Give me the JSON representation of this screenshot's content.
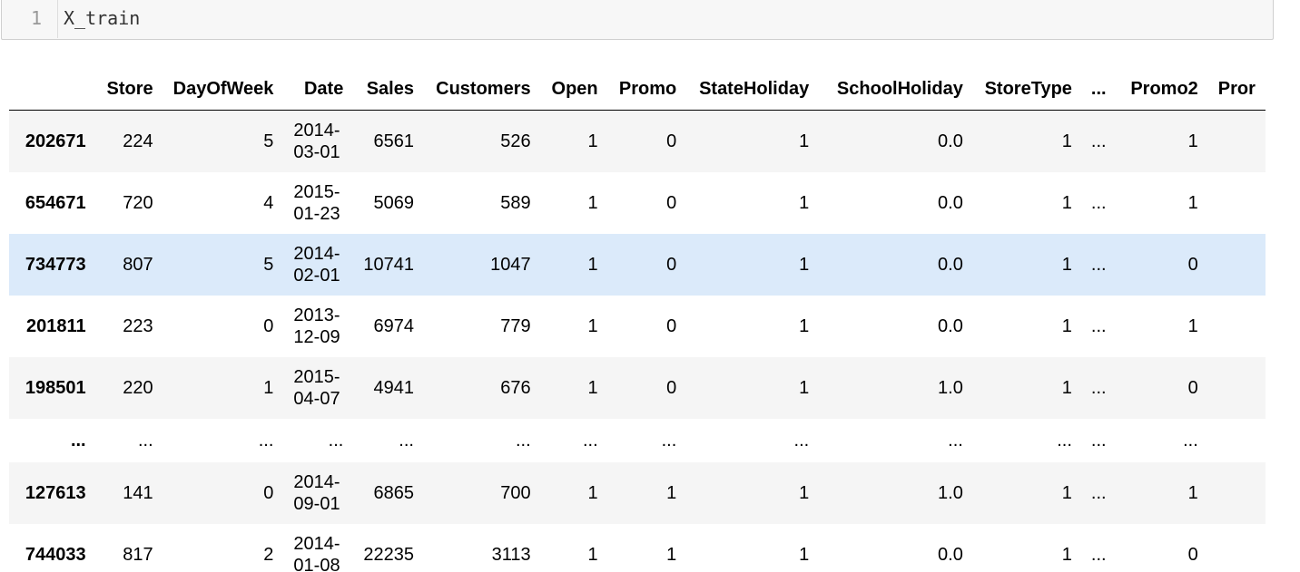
{
  "code_cell": {
    "line_number": "1",
    "code": "X_train"
  },
  "dataframe": {
    "columns": [
      "Store",
      "DayOfWeek",
      "Date",
      "Sales",
      "Customers",
      "Open",
      "Promo",
      "StateHoliday",
      "SchoolHoliday",
      "StoreType",
      "...",
      "Promo2",
      "Pror"
    ],
    "rows": [
      {
        "index": "202671",
        "cells": [
          "224",
          "5",
          "2014-\n03-01",
          "6561",
          "526",
          "1",
          "0",
          "1",
          "0.0",
          "1",
          "...",
          "1",
          ""
        ]
      },
      {
        "index": "654671",
        "cells": [
          "720",
          "4",
          "2015-\n01-23",
          "5069",
          "589",
          "1",
          "0",
          "1",
          "0.0",
          "1",
          "...",
          "1",
          ""
        ]
      },
      {
        "index": "734773",
        "cells": [
          "807",
          "5",
          "2014-\n02-01",
          "10741",
          "1047",
          "1",
          "0",
          "1",
          "0.0",
          "1",
          "...",
          "0",
          ""
        ]
      },
      {
        "index": "201811",
        "cells": [
          "223",
          "0",
          "2013-\n12-09",
          "6974",
          "779",
          "1",
          "0",
          "1",
          "0.0",
          "1",
          "...",
          "1",
          ""
        ]
      },
      {
        "index": "198501",
        "cells": [
          "220",
          "1",
          "2015-\n04-07",
          "4941",
          "676",
          "1",
          "0",
          "1",
          "1.0",
          "1",
          "...",
          "0",
          ""
        ]
      },
      {
        "index": "...",
        "cells": [
          "...",
          "...",
          "...",
          "...",
          "...",
          "...",
          "...",
          "...",
          "...",
          "...",
          "...",
          "...",
          ""
        ]
      },
      {
        "index": "127613",
        "cells": [
          "141",
          "0",
          "2014-\n09-01",
          "6865",
          "700",
          "1",
          "1",
          "1",
          "1.0",
          "1",
          "...",
          "1",
          ""
        ]
      },
      {
        "index": "744033",
        "cells": [
          "817",
          "2",
          "2014-\n01-08",
          "22235",
          "3113",
          "1",
          "1",
          "1",
          "0.0",
          "1",
          "...",
          "0",
          ""
        ]
      }
    ]
  },
  "colors": {
    "row_odd": "#f5f5f5",
    "row_hover": "#dbeafa",
    "code_bg": "#f7f7f7"
  }
}
